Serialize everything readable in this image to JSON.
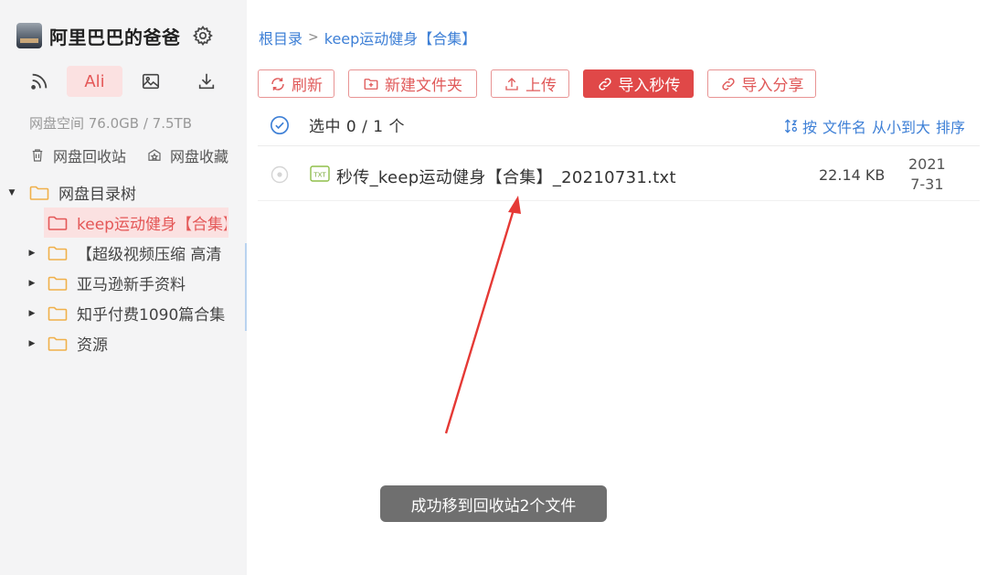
{
  "user": {
    "name": "阿里巴巴的爸爸"
  },
  "sidebar": {
    "tabs": [
      {
        "label": "",
        "icon": "rss-icon"
      },
      {
        "label": "Ali",
        "icon": ""
      },
      {
        "label": "",
        "icon": "image-icon"
      },
      {
        "label": "",
        "icon": "download-icon"
      }
    ],
    "quota": "网盘空间 76.0GB / 7.5TB",
    "quick": [
      {
        "label": "网盘回收站",
        "icon": "trash-icon"
      },
      {
        "label": "网盘收藏",
        "icon": "favorite-icon"
      }
    ],
    "tree": {
      "root_label": "网盘目录树",
      "items": [
        {
          "label": "keep运动健身【合集】"
        },
        {
          "label": "【超级视频压缩 高清"
        },
        {
          "label": "亚马逊新手资料"
        },
        {
          "label": "知乎付费1090篇合集"
        },
        {
          "label": "资源"
        }
      ]
    }
  },
  "breadcrumb": {
    "root": "根目录",
    "separator": ">",
    "current": "keep运动健身【合集】"
  },
  "toolbar": {
    "refresh": "刷新",
    "new_folder": "新建文件夹",
    "upload": "上传",
    "import_fast": "导入秒传",
    "import_share": "导入分享"
  },
  "list": {
    "selection": "选中 0 / 1 个",
    "sort": {
      "prefix": "按",
      "field": "文件名",
      "order": "从小到大",
      "action": "排序"
    },
    "files": [
      {
        "type_label": "TXT",
        "name": "秒传_keep运动健身【合集】_20210731.txt",
        "size": "22.14 KB",
        "date_year": "2021",
        "date_md": "7-31"
      }
    ]
  },
  "toast": "成功移到回收站2个文件",
  "colors": {
    "accent": "#e04848",
    "link": "#3d7fd6",
    "folder": "#f0b04a",
    "annotation": "#e53935"
  }
}
